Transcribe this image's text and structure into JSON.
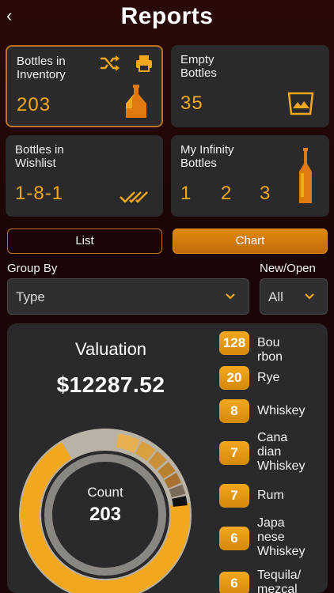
{
  "header": {
    "back": "‹",
    "title": "Reports"
  },
  "cards": {
    "inventory": {
      "label": "Bottles in Inventory",
      "value": "203"
    },
    "empty": {
      "label": "Empty Bottles",
      "value": "35"
    },
    "wishlist": {
      "label": "Bottles in Wishlist",
      "value": "1-8-1"
    },
    "infinity": {
      "label": "My Infinity Bottles",
      "v1": "1",
      "v2": "2",
      "v3": "3"
    }
  },
  "tabs": {
    "list": "List",
    "chart": "Chart"
  },
  "filters": {
    "group_by_label": "Group By",
    "group_by_value": "Type",
    "new_open_label": "New/Open",
    "new_open_value": "All"
  },
  "summary": {
    "valuation_label": "Valuation",
    "valuation_value": "$12287.52",
    "count_label": "Count",
    "count_value": "203"
  },
  "legend": [
    {
      "count": "128",
      "label": "Bou\nrbon"
    },
    {
      "count": "20",
      "label": "Rye"
    },
    {
      "count": "8",
      "label": "Whiskey"
    },
    {
      "count": "7",
      "label": "Cana\ndian\nWhiskey"
    },
    {
      "count": "7",
      "label": "Rum"
    },
    {
      "count": "6",
      "label": "Japa\nnese\nWhiskey"
    },
    {
      "count": "6",
      "label": "Tequila/\nmezcal"
    }
  ],
  "colors": {
    "accent": "#f2a81e",
    "border": "#b9732a",
    "card": "#2a2a2c"
  }
}
